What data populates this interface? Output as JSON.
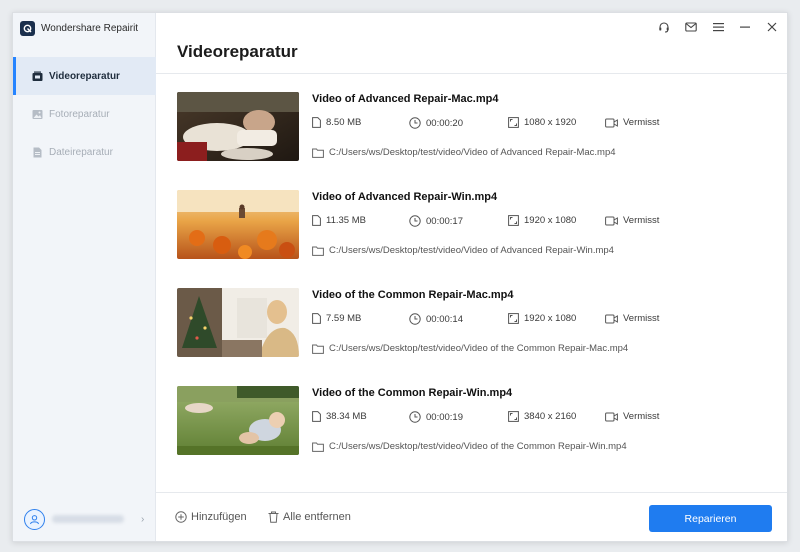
{
  "app": {
    "title": "Wondershare Repairit"
  },
  "sidebar": {
    "items": [
      {
        "label": "Videoreparatur",
        "icon": "video-repair-icon",
        "active": true
      },
      {
        "label": "Fotoreparatur",
        "icon": "photo-repair-icon",
        "active": false
      },
      {
        "label": "Dateireparatur",
        "icon": "file-repair-icon",
        "active": false
      }
    ]
  },
  "header": {
    "title": "Videoreparatur",
    "controls": [
      "headset-icon",
      "mail-icon",
      "menu-icon",
      "minimize-icon",
      "close-icon"
    ]
  },
  "files": [
    {
      "name": "Video of Advanced Repair-Mac.mp4",
      "size": "8.50  MB",
      "duration": "00:00:20",
      "resolution": "1080 x 1920",
      "status": "Vermisst",
      "path": "C:/Users/ws/Desktop/test/video/Video of Advanced Repair-Mac.mp4",
      "thumbnail": "hands-at-table"
    },
    {
      "name": "Video of Advanced Repair-Win.mp4",
      "size": "11.35  MB",
      "duration": "00:00:17",
      "resolution": "1920 x 1080",
      "status": "Vermisst",
      "path": "C:/Users/ws/Desktop/test/video/Video of Advanced Repair-Win.mp4",
      "thumbnail": "orange-flower-field"
    },
    {
      "name": "Video of the Common Repair-Mac.mp4",
      "size": "7.59  MB",
      "duration": "00:00:14",
      "resolution": "1920 x 1080",
      "status": "Vermisst",
      "path": "C:/Users/ws/Desktop/test/video/Video of the Common Repair-Mac.mp4",
      "thumbnail": "woman-christmas-room"
    },
    {
      "name": "Video of the Common Repair-Win.mp4",
      "size": "38.34  MB",
      "duration": "00:00:19",
      "resolution": "3840 x 2160",
      "status": "Vermisst",
      "path": "C:/Users/ws/Desktop/test/video/Video of the Common Repair-Win.mp4",
      "thumbnail": "baby-on-grass"
    }
  ],
  "footer": {
    "add_label": "Hinzufügen",
    "remove_all_label": "Alle entfernen",
    "repair_label": "Reparieren"
  },
  "colors": {
    "accent": "#1f7cf0",
    "sidebar_bg": "#f2f5f9",
    "active_nav_bg": "#e2eaf5"
  }
}
